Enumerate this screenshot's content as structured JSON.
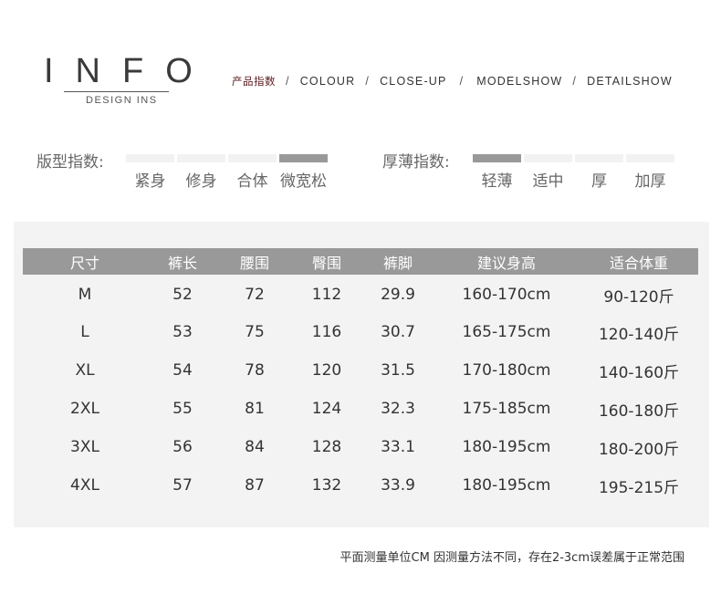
{
  "logo": {
    "title": "INFO",
    "subtitle": "DESIGN INS"
  },
  "nav": {
    "items": [
      {
        "label": "产品指数",
        "active": true
      },
      {
        "label": "COLOUR",
        "active": false
      },
      {
        "label": "CLOSE-UP",
        "active": false
      },
      {
        "label": "MODELSHOW",
        "active": false
      },
      {
        "label": "DETAILSHOW",
        "active": false
      }
    ],
    "separator": "/"
  },
  "fit_index": {
    "label": "版型指数:",
    "options": [
      "紧身",
      "修身",
      "合体",
      "微宽松"
    ],
    "selected_index": 3
  },
  "thickness_index": {
    "label": "厚薄指数:",
    "options": [
      "轻薄",
      "适中",
      "厚",
      "加厚"
    ],
    "selected_index": 0
  },
  "size_table": {
    "headers": [
      "尺寸",
      "裤长",
      "腰围",
      "臀围",
      "裤脚",
      "建议身高",
      "适合体重"
    ],
    "rows": [
      [
        "M",
        "52",
        "72",
        "112",
        "29.9",
        "160-170cm",
        "90-120斤"
      ],
      [
        "L",
        "53",
        "75",
        "116",
        "30.7",
        "165-175cm",
        "120-140斤"
      ],
      [
        "XL",
        "54",
        "78",
        "120",
        "31.5",
        "170-180cm",
        "140-160斤"
      ],
      [
        "2XL",
        "55",
        "81",
        "124",
        "32.3",
        "175-185cm",
        "160-180斤"
      ],
      [
        "3XL",
        "56",
        "84",
        "128",
        "33.1",
        "180-195cm",
        "180-200斤"
      ],
      [
        "4XL",
        "57",
        "87",
        "132",
        "33.9",
        "180-195cm",
        "195-215斤"
      ]
    ]
  },
  "footnote": "平面测量单位CM 因测量方法不同，存在2-3cm误差属于正常范围",
  "colors": {
    "header_bg": "#999999",
    "panel_bg": "#f3f3f3",
    "nav_active": "#5b1a1f",
    "bar_inactive": "#f2f2f2",
    "bar_active": "#999999"
  }
}
